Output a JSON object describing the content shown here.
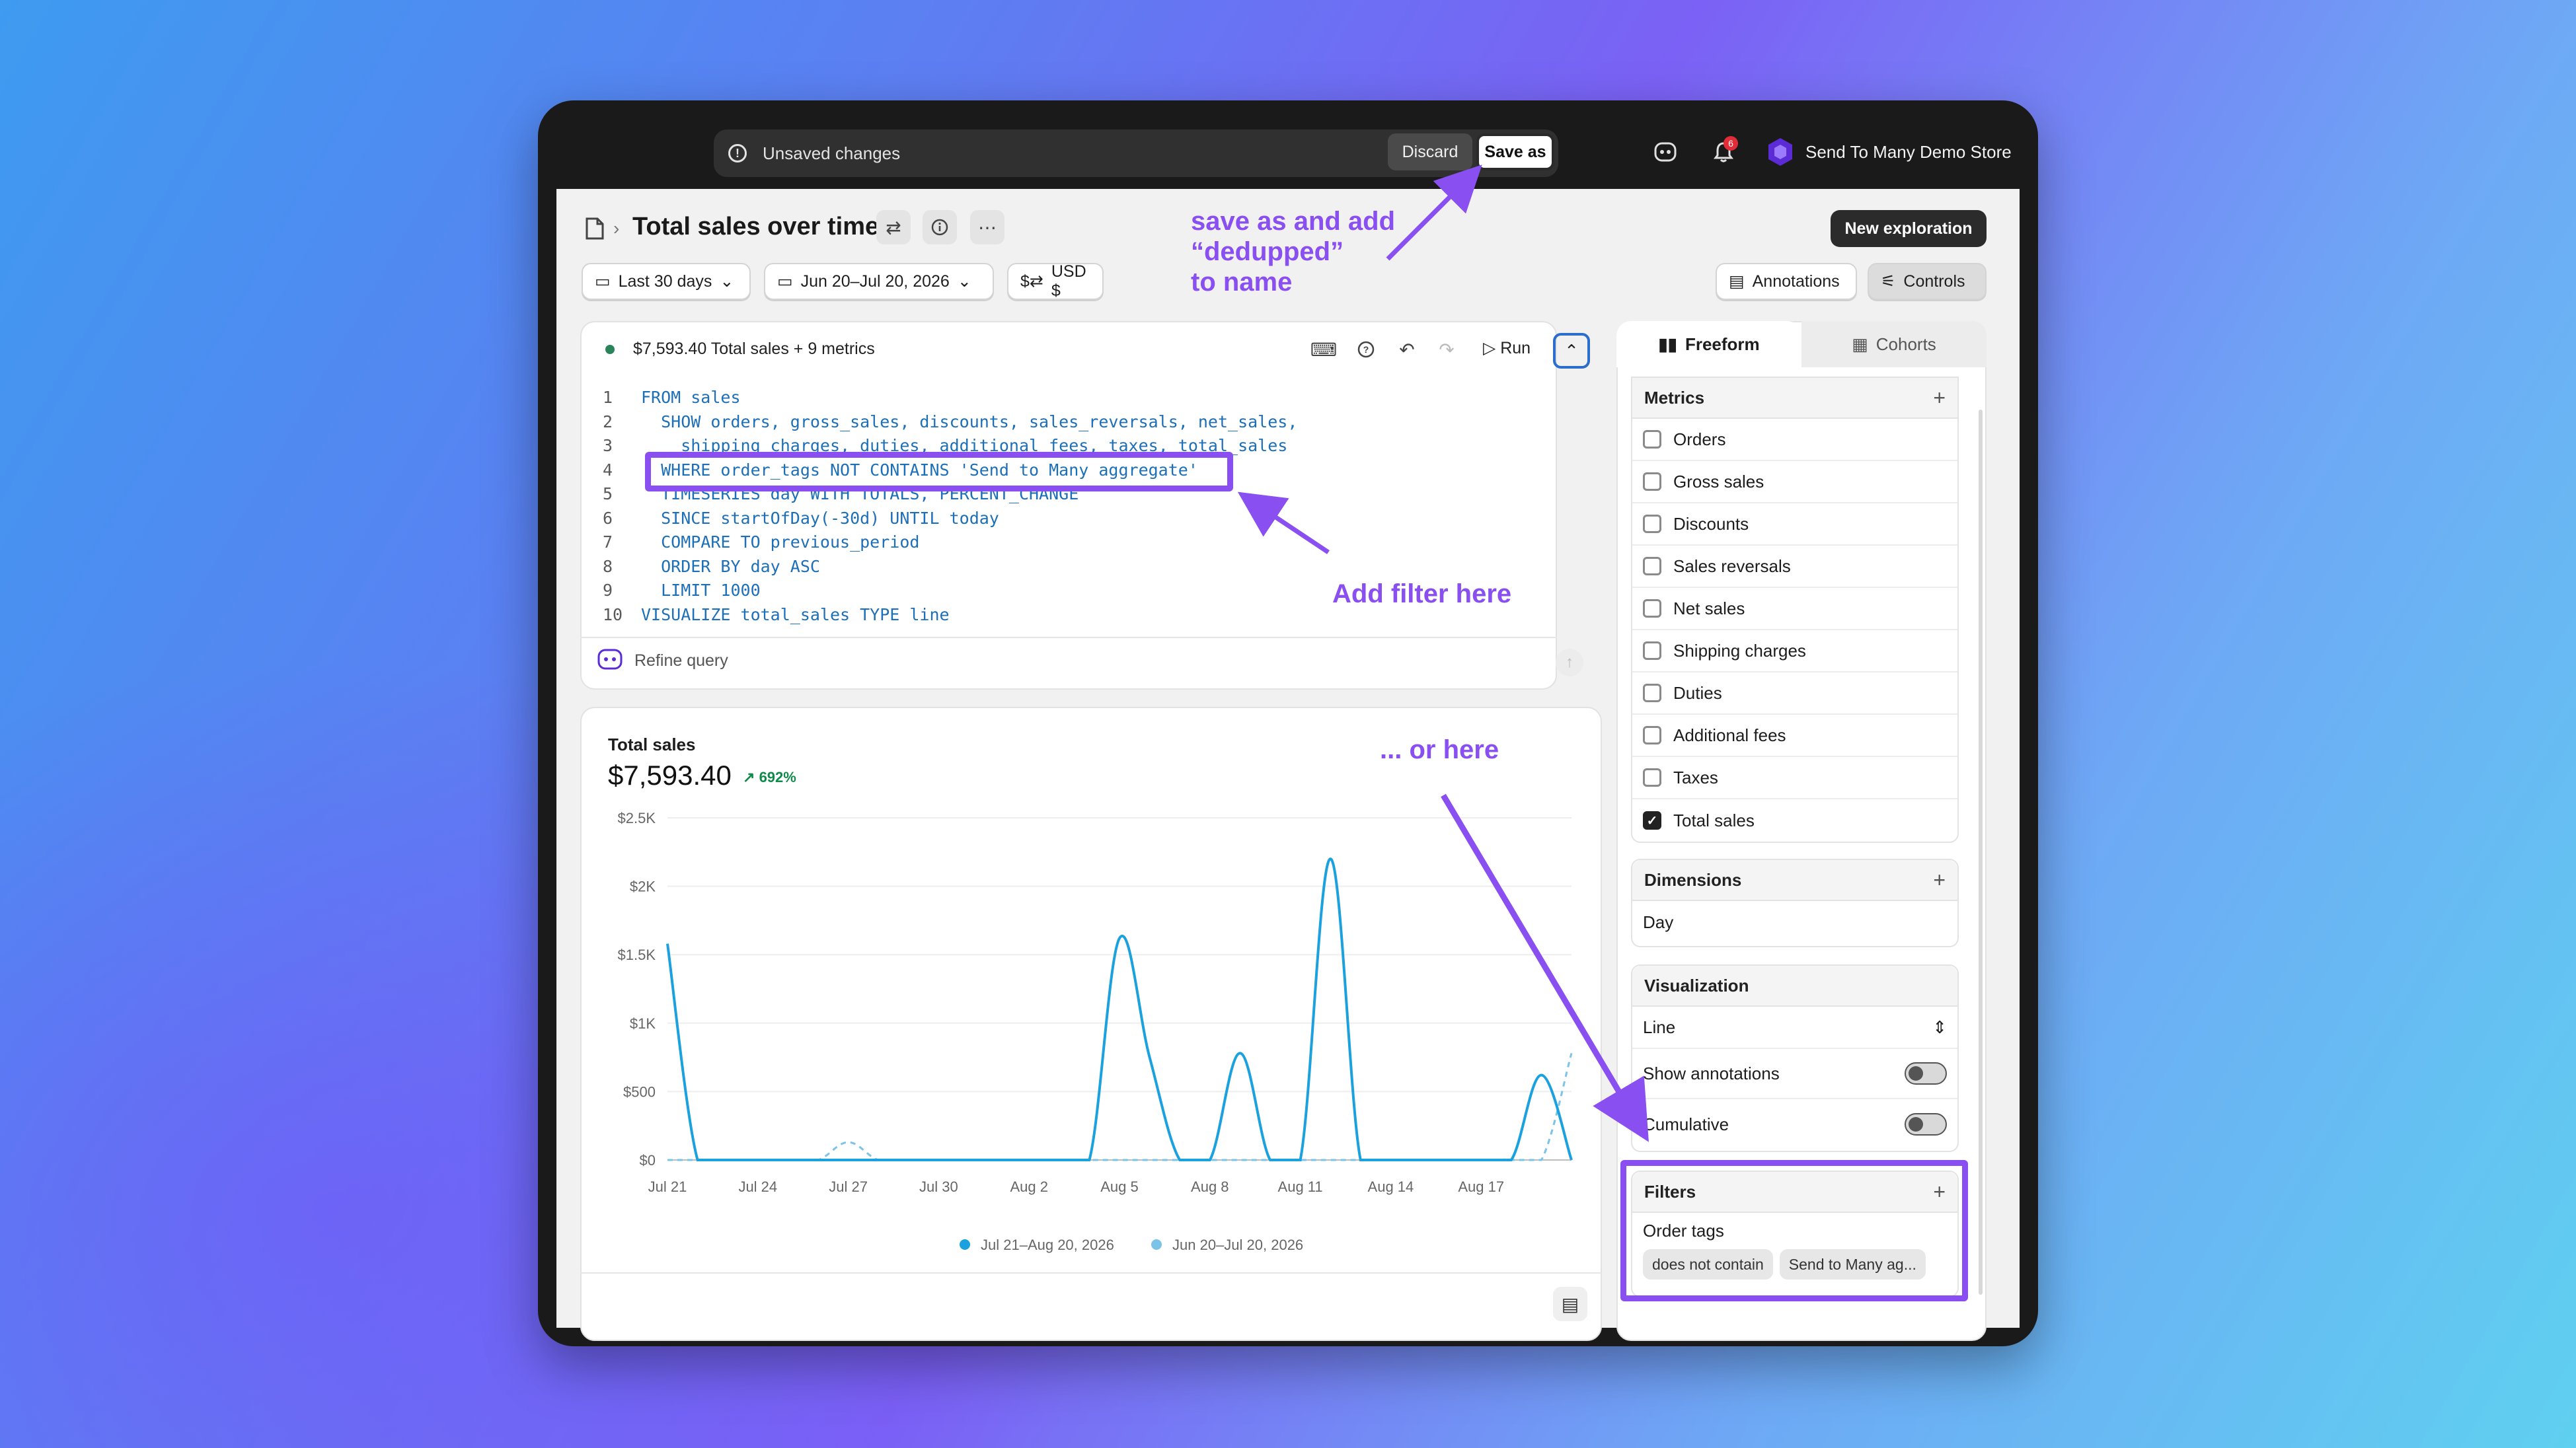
{
  "topbar": {
    "unsaved_text": "Unsaved changes",
    "discard_label": "Discard",
    "save_as_label": "Save as",
    "notification_count": "6",
    "store_name": "Send To Many Demo Store"
  },
  "header": {
    "title": "Total sales over time",
    "new_exploration_label": "New exploration",
    "annotations_label": "Annotations",
    "controls_label": "Controls",
    "date_range_label": "Last 30 days",
    "date_picker_label": "Jun 20–Jul 20, 2026",
    "currency_label": "USD $"
  },
  "query": {
    "status_text": "$7,593.40 Total sales + 9 metrics",
    "run_label": "Run",
    "refine_placeholder": "Refine query",
    "lines": [
      {
        "n": "1",
        "text": "FROM sales"
      },
      {
        "n": "2",
        "text": "  SHOW orders, gross_sales, discounts, sales_reversals, net_sales,"
      },
      {
        "n": "3",
        "text": "    shipping_charges, duties, additional_fees, taxes, total_sales"
      },
      {
        "n": "4",
        "text": "  WHERE order_tags NOT CONTAINS 'Send to Many aggregate'"
      },
      {
        "n": "5",
        "text": "  TIMESERIES day WITH TOTALS, PERCENT_CHANGE"
      },
      {
        "n": "6",
        "text": "  SINCE startOfDay(-30d) UNTIL today"
      },
      {
        "n": "7",
        "text": "  COMPARE TO previous_period"
      },
      {
        "n": "8",
        "text": "  ORDER BY day ASC"
      },
      {
        "n": "9",
        "text": "  LIMIT 1000"
      },
      {
        "n": "10",
        "text": "VISUALIZE total_sales TYPE line"
      }
    ]
  },
  "chart": {
    "title": "Total sales",
    "total": "$7,593.40",
    "delta": "692%"
  },
  "chart_data": {
    "type": "line",
    "title": "Total sales",
    "y_ticks": [
      "$0",
      "$500",
      "$1K",
      "$1.5K",
      "$2K",
      "$2.5K"
    ],
    "ylim": [
      0,
      2500
    ],
    "x_ticks": [
      "Jul 21",
      "Jul 24",
      "Jul 27",
      "Jul 30",
      "Aug 2",
      "Aug 5",
      "Aug 8",
      "Aug 11",
      "Aug 14",
      "Aug 17"
    ],
    "x": [
      "Jul 21",
      "Jul 22",
      "Jul 23",
      "Jul 24",
      "Jul 25",
      "Jul 26",
      "Jul 27",
      "Jul 28",
      "Jul 29",
      "Jul 30",
      "Jul 31",
      "Aug 1",
      "Aug 2",
      "Aug 3",
      "Aug 4",
      "Aug 5",
      "Aug 6",
      "Aug 7",
      "Aug 8",
      "Aug 9",
      "Aug 10",
      "Aug 11",
      "Aug 12",
      "Aug 13",
      "Aug 14",
      "Aug 15",
      "Aug 16",
      "Aug 17",
      "Aug 18",
      "Aug 19",
      "Aug 20"
    ],
    "series": [
      {
        "name": "Jul 21–Aug 20, 2026",
        "color": "#1aa1de",
        "style": "solid",
        "values": [
          1580,
          0,
          0,
          0,
          0,
          0,
          0,
          0,
          0,
          0,
          0,
          0,
          0,
          0,
          0,
          1620,
          750,
          0,
          0,
          780,
          0,
          0,
          2200,
          0,
          0,
          0,
          0,
          0,
          0,
          620,
          0
        ]
      },
      {
        "name": "Jun 20–Jul 20, 2026",
        "color": "#7cc3e8",
        "style": "dashed",
        "values": [
          0,
          0,
          0,
          0,
          0,
          0,
          130,
          0,
          0,
          0,
          0,
          0,
          0,
          0,
          0,
          0,
          0,
          0,
          0,
          0,
          0,
          0,
          0,
          0,
          0,
          0,
          0,
          0,
          0,
          0,
          780
        ]
      }
    ],
    "legend_position": "bottom"
  },
  "panel": {
    "tab_freeform": "Freeform",
    "tab_cohorts": "Cohorts",
    "metrics_title": "Metrics",
    "metrics": [
      {
        "label": "Orders",
        "checked": false
      },
      {
        "label": "Gross sales",
        "checked": false
      },
      {
        "label": "Discounts",
        "checked": false
      },
      {
        "label": "Sales reversals",
        "checked": false
      },
      {
        "label": "Net sales",
        "checked": false
      },
      {
        "label": "Shipping charges",
        "checked": false
      },
      {
        "label": "Duties",
        "checked": false
      },
      {
        "label": "Additional fees",
        "checked": false
      },
      {
        "label": "Taxes",
        "checked": false
      },
      {
        "label": "Total sales",
        "checked": true
      }
    ],
    "dimensions_title": "Dimensions",
    "dimension_value": "Day",
    "visualization_title": "Visualization",
    "visualization_value": "Line",
    "show_annotations_label": "Show annotations",
    "cumulative_label": "Cumulative",
    "filters_title": "Filters",
    "filter_field": "Order tags",
    "filter_operator": "does not contain",
    "filter_value": "Send to Many ag..."
  },
  "annotations": {
    "save_note_1": "save as and add",
    "save_note_2": "“dedupped”",
    "save_note_3": "to name",
    "filter_note": "Add filter here",
    "or_note": "... or here"
  },
  "colors": {
    "annotation": "#8a4ff1",
    "series_current": "#1aa1de",
    "series_previous": "#7cc3e8"
  }
}
